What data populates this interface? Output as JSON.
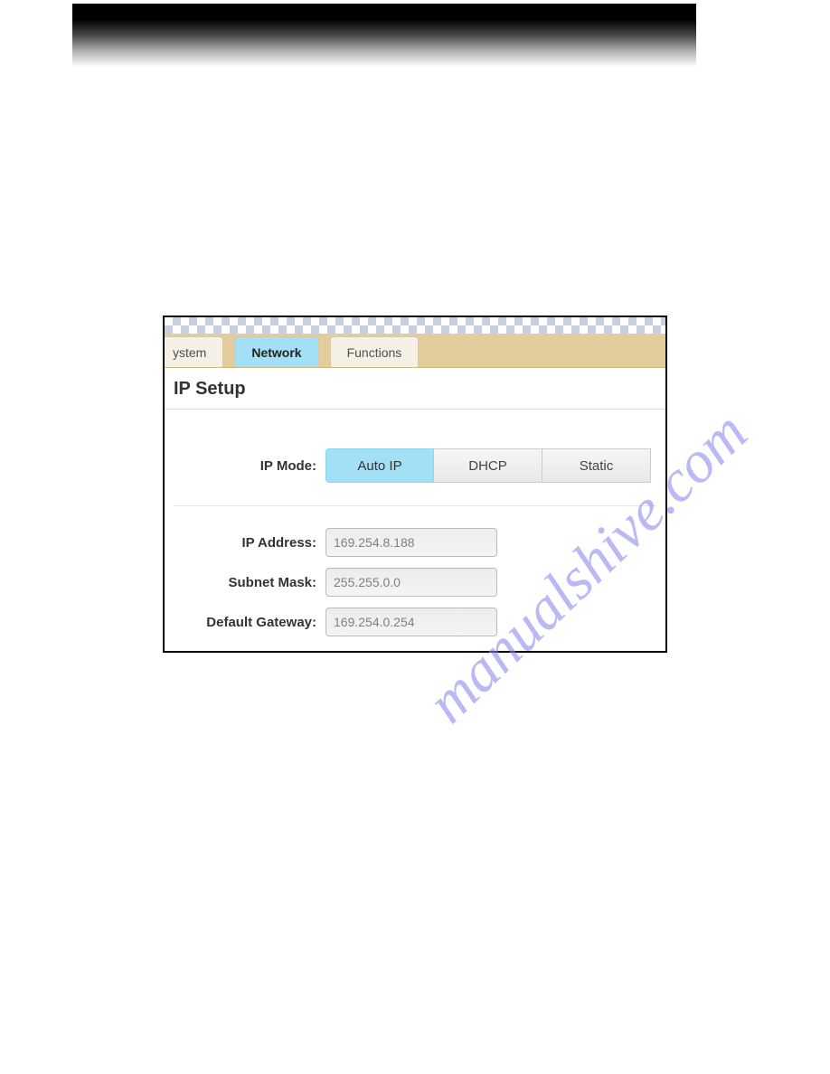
{
  "tabs": {
    "partial": "ystem",
    "active": "Network",
    "other": "Functions"
  },
  "section": {
    "title": "IP Setup"
  },
  "ip_mode": {
    "label": "IP Mode:",
    "options": {
      "auto": "Auto IP",
      "dhcp": "DHCP",
      "static": "Static"
    }
  },
  "fields": {
    "ip_address": {
      "label": "IP Address:",
      "value": "169.254.8.188"
    },
    "subnet_mask": {
      "label": "Subnet Mask:",
      "value": "255.255.0.0"
    },
    "default_gateway": {
      "label": "Default Gateway:",
      "value": "169.254.0.254"
    }
  },
  "watermark": "manualshive.com"
}
